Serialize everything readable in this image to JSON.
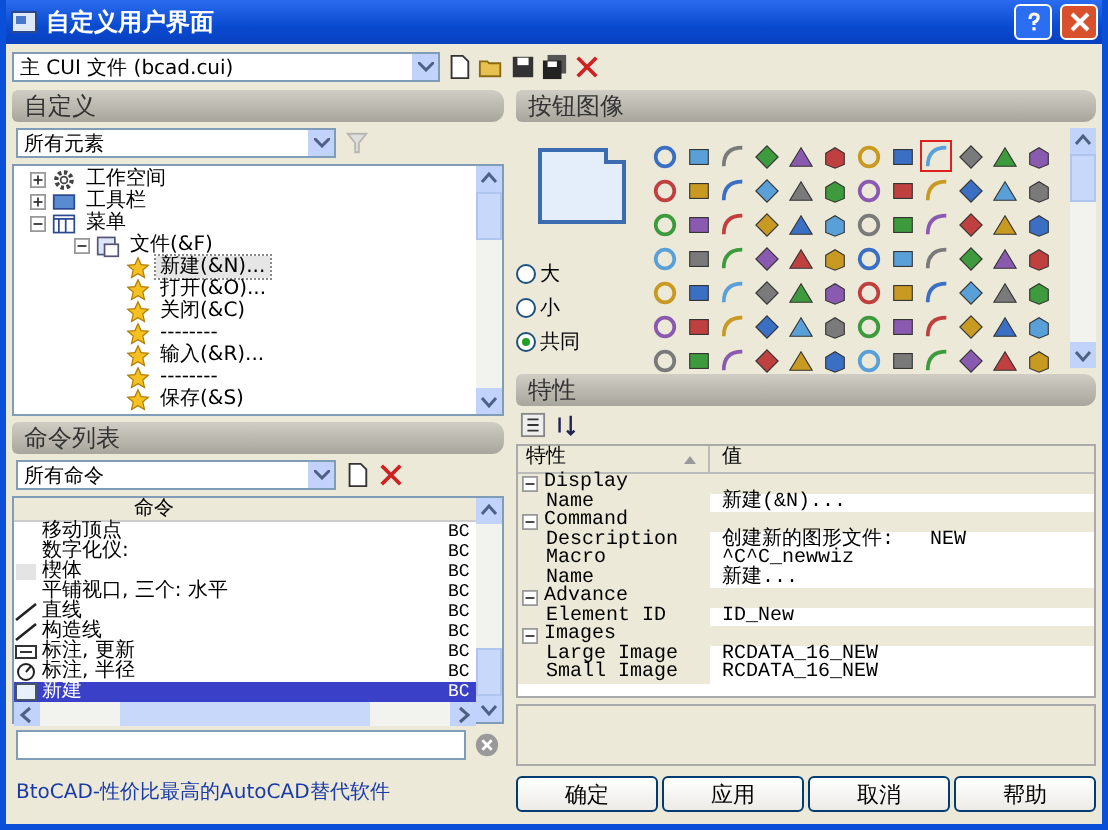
{
  "window": {
    "title": "自定义用户界面"
  },
  "cui_file": {
    "value": "主 CUI 文件 (bcad.cui)"
  },
  "customize": {
    "title": "自定义",
    "filter": "所有元素",
    "tree": [
      {
        "label": "工作空间",
        "kind": "workspace",
        "expanded": false,
        "selected": false
      },
      {
        "label": "工具栏",
        "kind": "toolbar",
        "expanded": false,
        "selected": false
      },
      {
        "label": "菜单",
        "kind": "menu",
        "expanded": true,
        "selected": false,
        "children": [
          {
            "label": "文件(&F)",
            "kind": "folder",
            "expanded": true,
            "selected": false,
            "children": [
              {
                "label": "新建(&N)...",
                "kind": "item",
                "selected": true
              },
              {
                "label": "打开(&O)...",
                "kind": "item",
                "selected": false
              },
              {
                "label": "关闭(&C)",
                "kind": "item",
                "selected": false
              },
              {
                "label": "--------",
                "kind": "item",
                "selected": false
              },
              {
                "label": "输入(&R)...",
                "kind": "item",
                "selected": false
              },
              {
                "label": "--------",
                "kind": "item",
                "selected": false
              },
              {
                "label": "保存(&S)",
                "kind": "item",
                "selected": false
              }
            ]
          }
        ]
      }
    ]
  },
  "command_list": {
    "title": "命令列表",
    "filter": "所有命令",
    "column_1": "命令",
    "rows": [
      {
        "name": "移动顶点",
        "source": "BC",
        "kind": "none",
        "selected": false
      },
      {
        "name": "数字化仪:",
        "source": "BC",
        "kind": "none",
        "selected": false
      },
      {
        "name": "楔体",
        "source": "BC",
        "kind": "blank",
        "selected": false
      },
      {
        "name": "平铺视口, 三个: 水平",
        "source": "BC",
        "kind": "none",
        "selected": false
      },
      {
        "name": "直线",
        "source": "BC",
        "kind": "line",
        "selected": false
      },
      {
        "name": "构造线",
        "source": "BC",
        "kind": "line",
        "selected": false
      },
      {
        "name": "标注, 更新",
        "source": "BC",
        "kind": "dimension",
        "selected": false
      },
      {
        "name": "标注, 半径",
        "source": "BC",
        "kind": "radius",
        "selected": false
      },
      {
        "name": "新建",
        "source": "BC",
        "kind": "new",
        "selected": true
      }
    ]
  },
  "footer_link": "BtoCAD-性价比最高的AutoCAD替代软件",
  "button_image": {
    "title": "按钮图像",
    "sizes": [
      {
        "label": "大",
        "selected": false
      },
      {
        "label": "小",
        "selected": false
      },
      {
        "label": "共同",
        "selected": true
      }
    ],
    "images": [
      {
        "selected": false
      },
      {
        "selected": false
      },
      {
        "selected": false
      },
      {
        "selected": false
      },
      {
        "selected": false
      },
      {
        "selected": false
      },
      {
        "selected": false
      },
      {
        "selected": false
      },
      {
        "selected": true
      },
      {
        "selected": false
      },
      {
        "selected": false
      },
      {
        "selected": false
      },
      {
        "selected": false
      },
      {
        "selected": false
      },
      {
        "selected": false
      },
      {
        "selected": false
      },
      {
        "selected": false
      },
      {
        "selected": false
      },
      {
        "selected": false
      },
      {
        "selected": false
      },
      {
        "selected": false
      },
      {
        "selected": false
      },
      {
        "selected": false
      },
      {
        "selected": false
      },
      {
        "selected": false
      },
      {
        "selected": false
      },
      {
        "selected": false
      },
      {
        "selected": false
      },
      {
        "selected": false
      },
      {
        "selected": false
      },
      {
        "selected": false
      },
      {
        "selected": false
      },
      {
        "selected": false
      },
      {
        "selected": false
      },
      {
        "selected": false
      },
      {
        "selected": false
      },
      {
        "selected": false
      },
      {
        "selected": false
      },
      {
        "selected": false
      },
      {
        "selected": false
      },
      {
        "selected": false
      },
      {
        "selected": false
      },
      {
        "selected": false
      },
      {
        "selected": false
      },
      {
        "selected": false
      },
      {
        "selected": false
      },
      {
        "selected": false
      },
      {
        "selected": false
      },
      {
        "selected": false
      },
      {
        "selected": false
      },
      {
        "selected": false
      },
      {
        "selected": false
      },
      {
        "selected": false
      },
      {
        "selected": false
      },
      {
        "selected": false
      },
      {
        "selected": false
      },
      {
        "selected": false
      },
      {
        "selected": false
      },
      {
        "selected": false
      },
      {
        "selected": false
      },
      {
        "selected": false
      },
      {
        "selected": false
      },
      {
        "selected": false
      },
      {
        "selected": false
      },
      {
        "selected": false
      },
      {
        "selected": false
      },
      {
        "selected": false
      },
      {
        "selected": false
      },
      {
        "selected": false
      },
      {
        "selected": false
      },
      {
        "selected": false
      },
      {
        "selected": false
      },
      {
        "selected": false
      },
      {
        "selected": false
      },
      {
        "selected": false
      },
      {
        "selected": false
      },
      {
        "selected": false
      },
      {
        "selected": false
      },
      {
        "selected": false
      },
      {
        "selected": false
      },
      {
        "selected": false
      },
      {
        "selected": false
      },
      {
        "selected": false
      },
      {
        "selected": false
      }
    ]
  },
  "properties": {
    "title": "特性",
    "columns": [
      "特性",
      "值"
    ],
    "categories": [
      {
        "name": "Display",
        "expanded": true,
        "rows": [
          {
            "name": "Name",
            "value": "新建(&N)..."
          }
        ]
      },
      {
        "name": "Command",
        "expanded": true,
        "rows": [
          {
            "name": "Description",
            "value": "创建新的图形文件:   NEW"
          },
          {
            "name": "Macro",
            "value": "^C^C_newwiz"
          },
          {
            "name": "Name",
            "value": "新建..."
          }
        ]
      },
      {
        "name": "Advance",
        "expanded": true,
        "rows": [
          {
            "name": "Element ID",
            "value": "ID_New"
          }
        ]
      },
      {
        "name": "Images",
        "expanded": true,
        "rows": [
          {
            "name": "Large Image",
            "value": "RCDATA_16_NEW"
          },
          {
            "name": "Small Image",
            "value": "RCDATA_16_NEW"
          }
        ]
      }
    ]
  },
  "buttons": [
    "确定",
    "应用",
    "取消",
    "帮助"
  ]
}
